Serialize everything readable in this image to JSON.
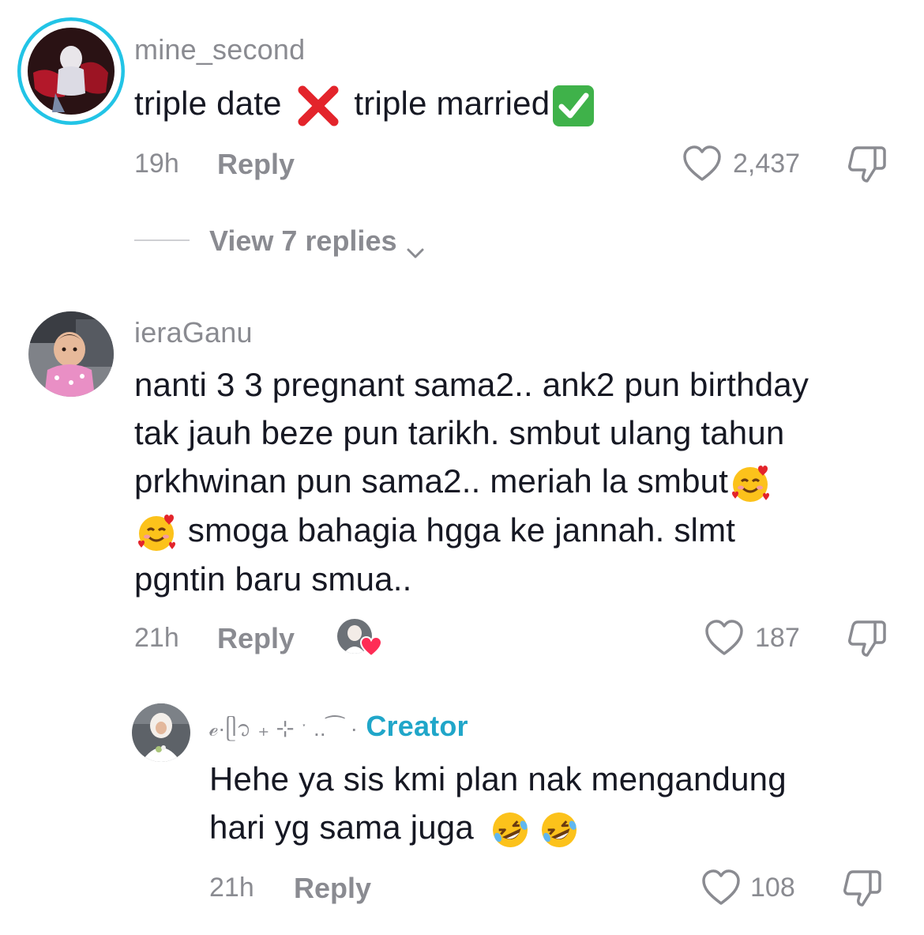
{
  "comments": [
    {
      "username": "mine_second",
      "text_a": "triple date ",
      "text_b": " triple married",
      "time": "19h",
      "reply_label": "Reply",
      "likes": "2,437",
      "view_replies": "View 7 replies"
    },
    {
      "username": "ieraGanu",
      "lines": [
        "nanti 3 3 pregnant sama2.. ank2 pun birthday",
        "tak jauh beze pun tarikh. smbut ulang tahun",
        "prkhwinan pun sama2.. meriah la smbut",
        " smoga bahagia hgga ke jannah. slmt",
        "pgntin baru smua.."
      ],
      "time": "21h",
      "reply_label": "Reply",
      "likes": "187"
    },
    {
      "username": "ℯ·ᥫ᭡ ₊ ⊹ ˑ ..⁀ ·",
      "badge": "Creator",
      "lines": [
        "Hehe ya sis kmi plan nak mengandung",
        "hari yg sama juga "
      ],
      "time": "21h",
      "reply_label": "Reply",
      "likes": "108"
    }
  ],
  "icons": {
    "heart": "heart-outline-icon",
    "dislike": "thumbs-down-icon",
    "chevron": "chevron-down-icon"
  },
  "colors": {
    "accent_creator": "#20a6c9",
    "ring": "#22c4e6",
    "muted": "#8a8b91"
  }
}
